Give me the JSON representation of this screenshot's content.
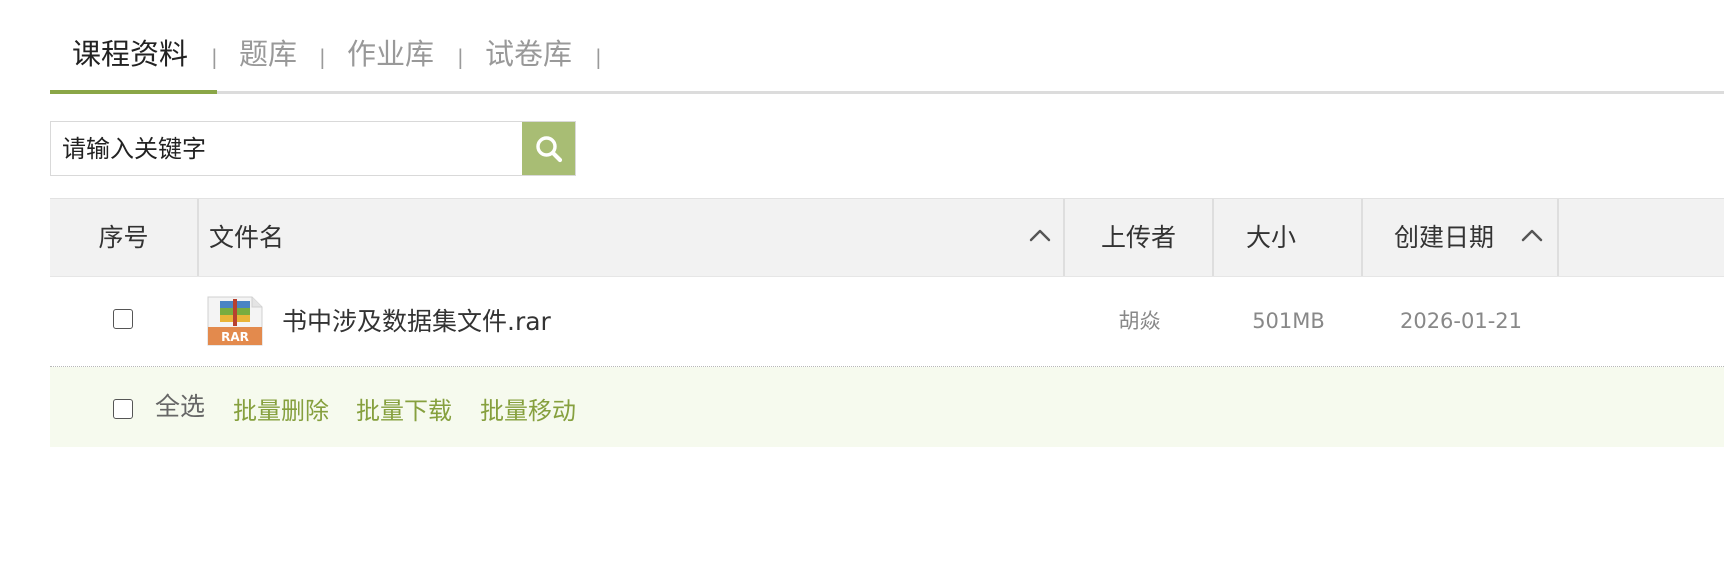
{
  "tabs": [
    {
      "label": "课程资料",
      "active": true
    },
    {
      "label": "题库",
      "active": false
    },
    {
      "label": "作业库",
      "active": false
    },
    {
      "label": "试卷库",
      "active": false
    }
  ],
  "tab_separator": "|",
  "search": {
    "placeholder": "请输入关键字",
    "icon": "search-icon"
  },
  "table": {
    "columns": {
      "index": "序号",
      "filename": "文件名",
      "uploader": "上传者",
      "size": "大小",
      "created": "创建日期"
    },
    "rows": [
      {
        "file_icon": "rar-file-icon",
        "filename": "书中涉及数据集文件.rar",
        "uploader": "胡焱",
        "size": "501MB",
        "created": "2026-01-21"
      }
    ]
  },
  "footer": {
    "select_all": "全选",
    "batch_delete": "批量删除",
    "batch_download": "批量下载",
    "batch_move": "批量移动"
  },
  "colors": {
    "accent": "#8aa647",
    "search_button": "#a8bd74",
    "link": "#86a03e",
    "footer_bg": "#f6faee",
    "header_bg": "#f2f2f2"
  }
}
